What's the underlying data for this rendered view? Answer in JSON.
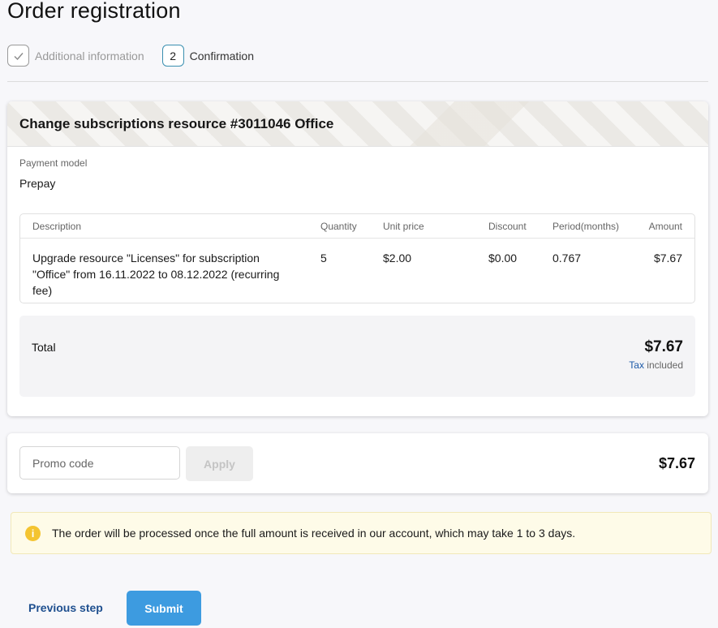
{
  "page": {
    "title": "Order registration"
  },
  "stepper": {
    "steps": [
      {
        "marker": "✓",
        "label": "Additional information",
        "state": "done"
      },
      {
        "marker": "2",
        "label": "Confirmation",
        "state": "active"
      }
    ]
  },
  "order": {
    "title": "Change subscriptions resource #3011046 Office",
    "payment_model_label": "Payment model",
    "payment_model_value": "Prepay",
    "table": {
      "headers": {
        "description": "Description",
        "quantity": "Quantity",
        "unit_price": "Unit price",
        "discount": "Discount",
        "period": "Period(months)",
        "amount": "Amount"
      },
      "rows": [
        {
          "description": "Upgrade resource \"Licenses\" for subscription \"Office\" from 16.11.2022 to 08.12.2022 (recurring fee)",
          "quantity": "5",
          "unit_price": "$2.00",
          "discount": "$0.00",
          "period": "0.767",
          "amount": "$7.67"
        }
      ]
    },
    "total_label": "Total",
    "total_amount": "$7.67",
    "tax_link": "Tax",
    "tax_suffix": " included"
  },
  "promo": {
    "placeholder": "Promo code",
    "apply_label": "Apply",
    "total": "$7.67"
  },
  "info": {
    "icon": "info-icon",
    "text": "The order will be processed once the full amount is received in our account, which may take 1 to 3 days."
  },
  "actions": {
    "previous_label": "Previous step",
    "submit_label": "Submit"
  },
  "colors": {
    "accent": "#3d9be0",
    "link": "#1e4f8f",
    "info_icon": "#f4c430",
    "info_bg": "#fefbe8"
  }
}
